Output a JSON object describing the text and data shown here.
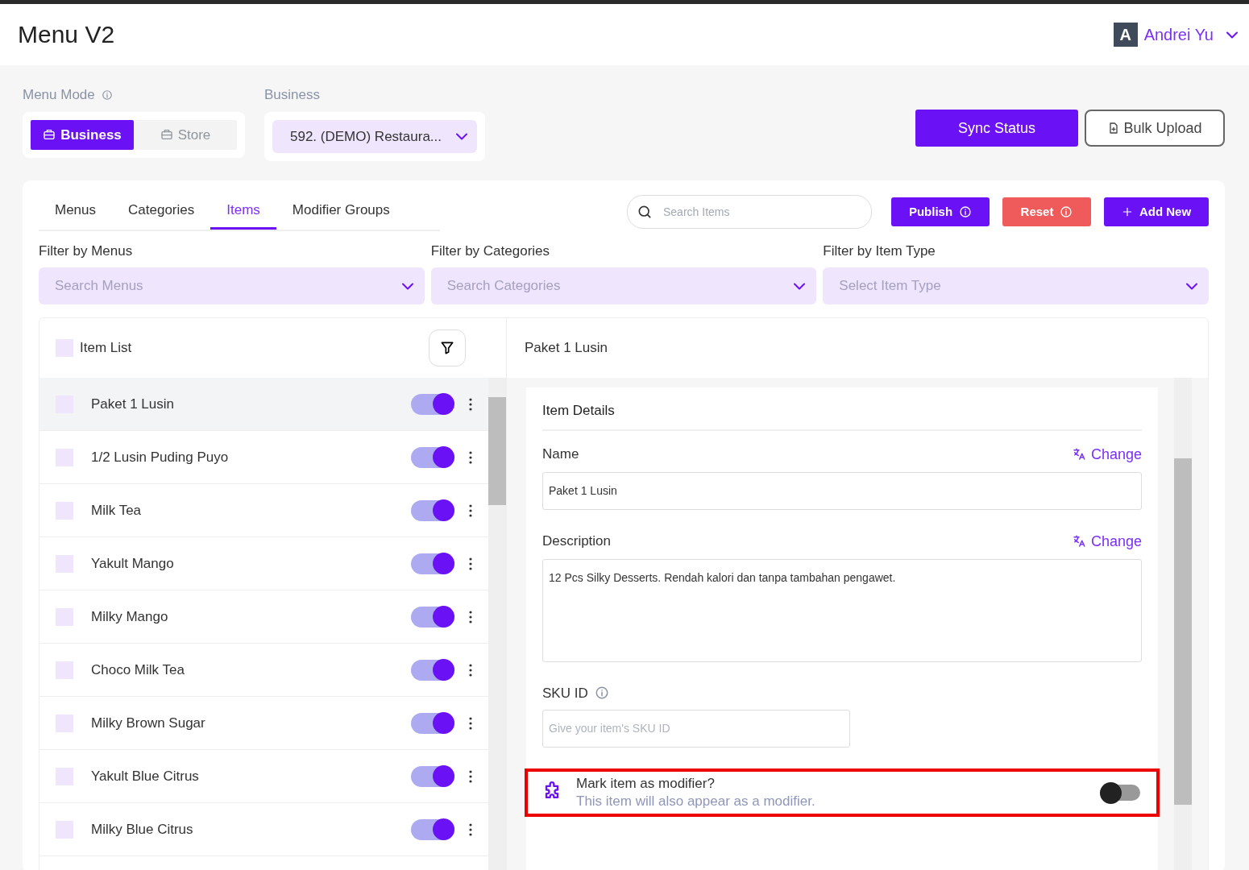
{
  "header": {
    "title": "Menu V2",
    "user": {
      "initial": "A",
      "name": "Andrei Yu"
    }
  },
  "menu_mode": {
    "label": "Menu Mode",
    "options": [
      {
        "label": "Business",
        "selected": true
      },
      {
        "label": "Store",
        "selected": false
      }
    ]
  },
  "business": {
    "label": "Business",
    "value": "592. (DEMO) Restaura..."
  },
  "actions": [
    {
      "label": "Sync Status",
      "kind": "primary"
    },
    {
      "label": "Bulk Upload",
      "kind": "outline"
    }
  ],
  "tabs": [
    {
      "label": "Menus",
      "selected": false
    },
    {
      "label": "Categories",
      "selected": false
    },
    {
      "label": "Items",
      "selected": true
    },
    {
      "label": "Modifier Groups",
      "selected": false
    }
  ],
  "search": {
    "placeholder": "Search Items"
  },
  "toolbar_buttons": [
    {
      "label": "Publish",
      "kind": "primary"
    },
    {
      "label": "Reset",
      "kind": "danger"
    },
    {
      "label": "Add New",
      "kind": "add"
    }
  ],
  "filters": [
    {
      "label": "Filter by Menus",
      "placeholder": "Search Menus"
    },
    {
      "label": "Filter by Categories",
      "placeholder": "Search Categories"
    },
    {
      "label": "Filter by Item Type",
      "placeholder": "Select Item Type"
    }
  ],
  "item_list": {
    "title": "Item List",
    "checked": false,
    "items": [
      {
        "name": "Paket 1 Lusin",
        "selected": true,
        "checked": false,
        "on": true
      },
      {
        "name": "1/2 Lusin Puding Puyo",
        "selected": false,
        "checked": false,
        "on": true
      },
      {
        "name": "Milk Tea",
        "selected": false,
        "checked": false,
        "on": true
      },
      {
        "name": "Yakult Mango",
        "selected": false,
        "checked": false,
        "on": true
      },
      {
        "name": "Milky Mango",
        "selected": false,
        "checked": false,
        "on": true
      },
      {
        "name": "Choco Milk Tea",
        "selected": false,
        "checked": false,
        "on": true
      },
      {
        "name": "Milky Brown Sugar",
        "selected": false,
        "checked": false,
        "on": true
      },
      {
        "name": "Yakult Blue Citrus",
        "selected": false,
        "checked": false,
        "on": true
      },
      {
        "name": "Milky Blue Citrus",
        "selected": false,
        "checked": false,
        "on": true
      }
    ]
  },
  "detail": {
    "title": "Paket 1 Lusin",
    "section": "Item Details",
    "fields": [
      {
        "kind": "input",
        "label": "Name",
        "action": "Change",
        "value": "Paket 1 Lusin"
      },
      {
        "kind": "textarea",
        "label": "Description",
        "action": "Change",
        "value": "12 Pcs Silky Desserts. Rendah kalori dan tanpa tambahan pengawet."
      },
      {
        "kind": "short",
        "label": "SKU ID",
        "info": true,
        "placeholder": "Give your item's SKU ID"
      }
    ],
    "modifier": {
      "title": "Mark item as modifier?",
      "subtitle": "This item will also appear as a modifier.",
      "on": false,
      "highlighted": true
    }
  }
}
